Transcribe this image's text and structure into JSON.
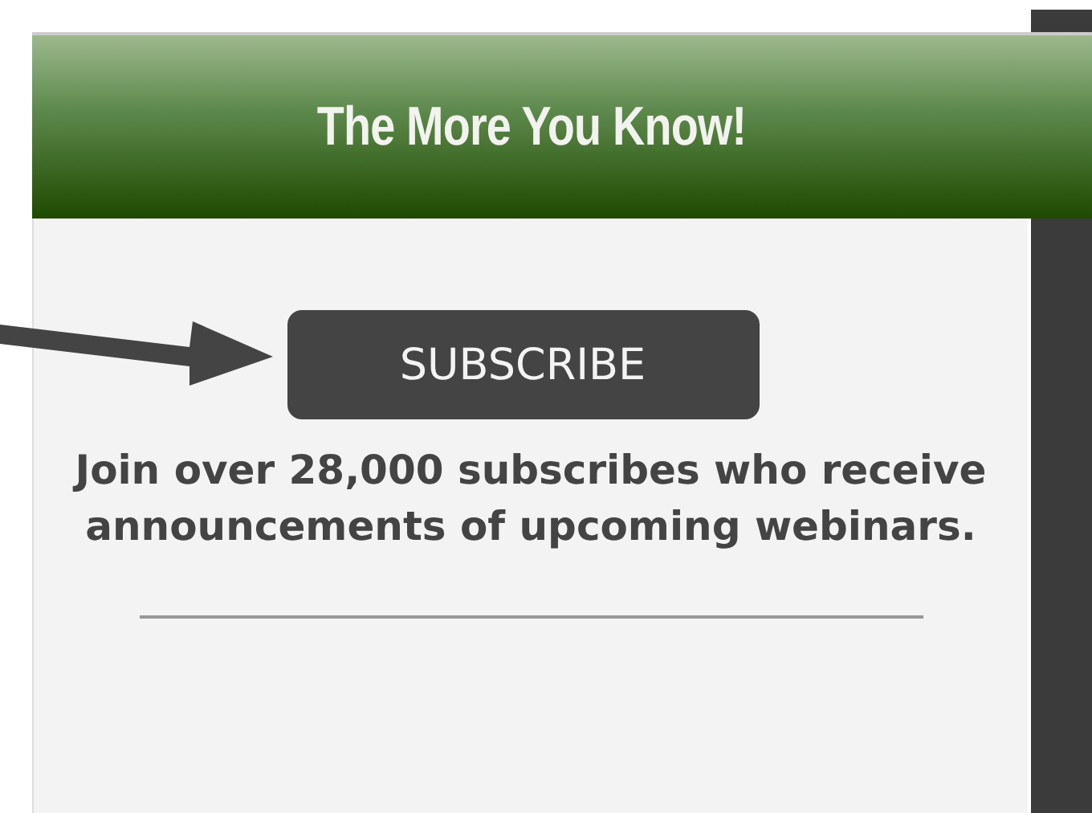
{
  "header": {
    "title": "The More You Know!"
  },
  "subscribe_button": {
    "label": "SUBSCRIBE"
  },
  "description": "Join over 28,000 subscribes who receive announcements of upcoming webinars."
}
